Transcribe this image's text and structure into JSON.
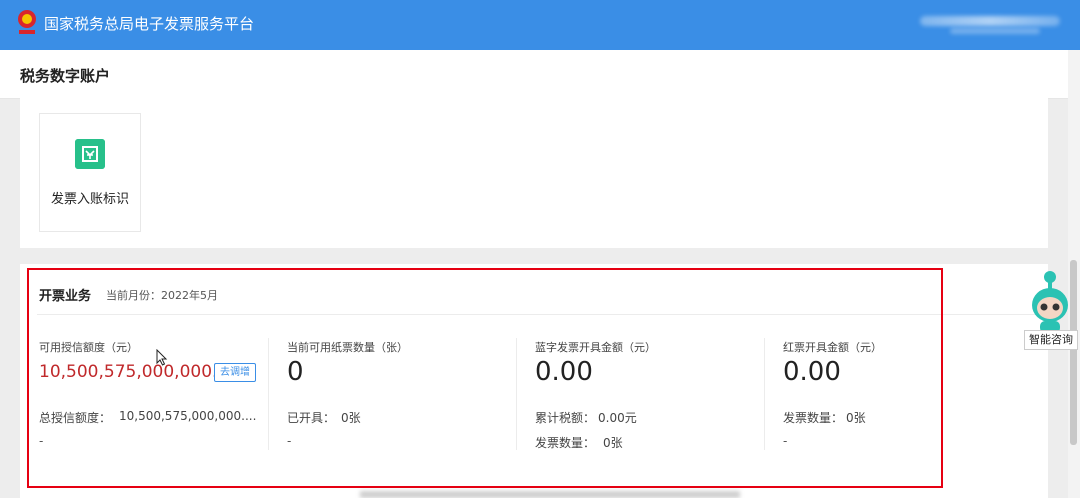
{
  "header": {
    "app_title": "国家税务总局电子发票服务平台",
    "logo_icon": "tax-emblem-icon"
  },
  "page": {
    "title": "税务数字账户"
  },
  "tiles": [
    {
      "label": "发票入账标识",
      "icon": "invoice-entry-icon"
    }
  ],
  "invoicing": {
    "title": "开票业务",
    "month": "当前月份：2022年5月",
    "credit": {
      "label": "可用授信额度（元）",
      "value": "10,500,575,000,000.00",
      "adjust_label": "去调增",
      "total_label": "总授信额度：",
      "total_value": "10,500,575,000,000....",
      "dash": "-"
    },
    "paper": {
      "label": "当前可用纸票数量（张）",
      "value": "0",
      "issued_label": "已开具：",
      "issued_value": "0张",
      "dash": "-"
    },
    "blue": {
      "label": "蓝字发票开具金额（元）",
      "value": "0.00",
      "tax_label": "累计税额：",
      "tax_value": "0.00元",
      "count_label": "发票数量：",
      "count_value": "0张"
    },
    "red": {
      "label": "红票开具金额（元）",
      "value": "0.00",
      "count_label": "发票数量：",
      "count_value": "0张",
      "dash": "-"
    }
  },
  "assistant": {
    "label": "智能咨询",
    "icon": "robot-assistant-icon"
  },
  "colors": {
    "header_blue": "#3a8ee6",
    "credit_red": "#c0292b",
    "highlight_frame": "#e60012",
    "tile_green": "#27c08a"
  }
}
